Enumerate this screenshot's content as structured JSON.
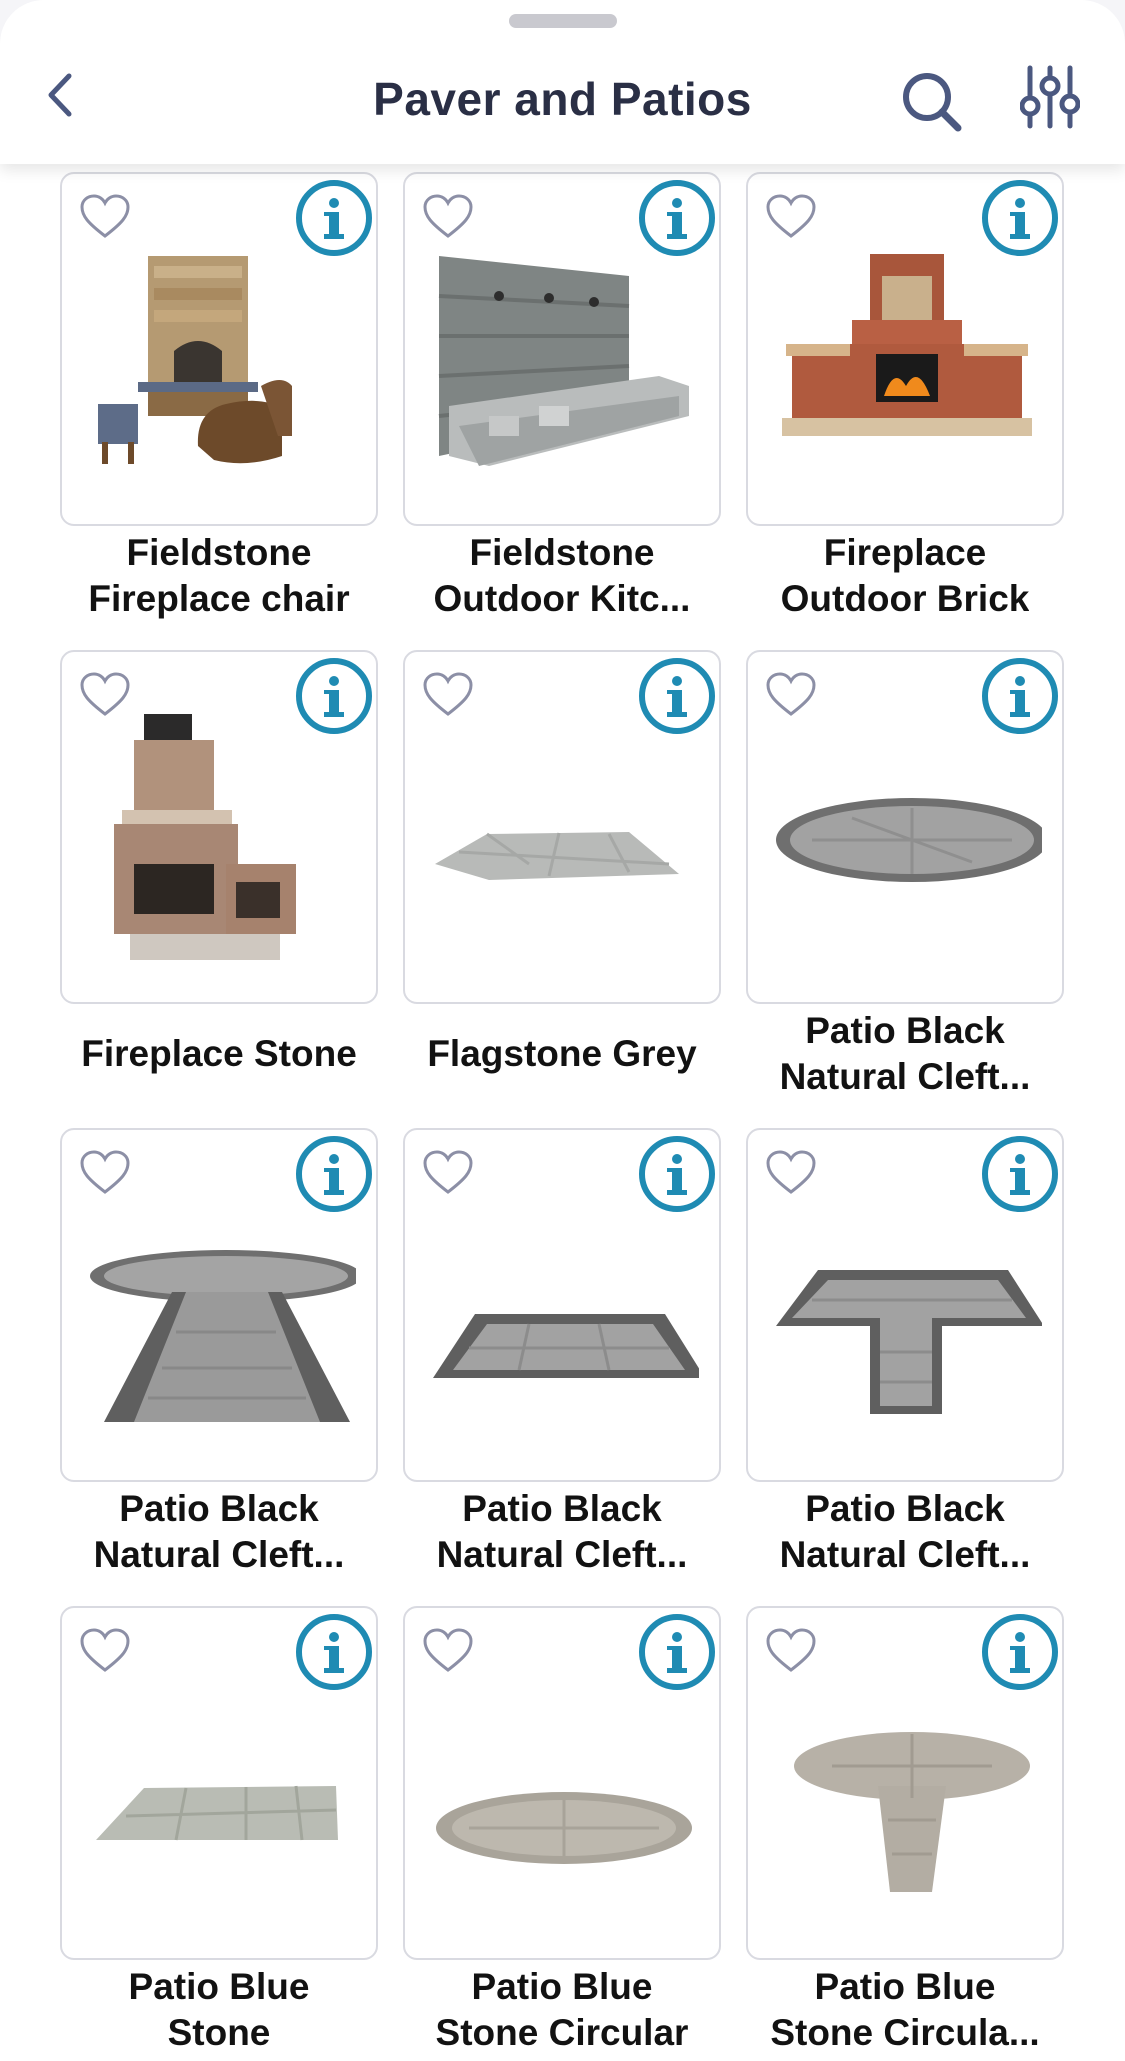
{
  "header": {
    "title": "Paver and Patios"
  },
  "colors": {
    "accent": "#1f8bb3",
    "title": "#2a2f45",
    "icon": "#4b5880",
    "heart": "#8c8fa6"
  },
  "icons": {
    "back": "chevron-left-icon",
    "search": "search-icon",
    "filter": "sliders-icon",
    "favorite": "heart-outline-icon",
    "info": "info-circle-icon"
  },
  "products": [
    {
      "line1": "Fieldstone",
      "line2": "Fireplace chair",
      "image": "fieldstone-fireplace-with-wicker-chairs"
    },
    {
      "line1": "Fieldstone",
      "line2": "Outdoor Kitc...",
      "image": "stone-outdoor-kitchen"
    },
    {
      "line1": "Fireplace",
      "line2": "Outdoor Brick",
      "image": "brick-outdoor-fireplace"
    },
    {
      "line1": "Fireplace Stone",
      "line2": "",
      "image": "stone-fireplace"
    },
    {
      "line1": "Flagstone Grey",
      "line2": "",
      "image": "grey-flagstone-slab"
    },
    {
      "line1": "Patio Black",
      "line2": "Natural Cleft...",
      "image": "round-grey-patio"
    },
    {
      "line1": "Patio Black",
      "line2": "Natural Cleft...",
      "image": "round-patio-with-path"
    },
    {
      "line1": "Patio Black",
      "line2": "Natural Cleft...",
      "image": "square-patio"
    },
    {
      "line1": "Patio Black",
      "line2": "Natural Cleft...",
      "image": "t-shaped-patio"
    },
    {
      "line1": "Patio Blue",
      "line2": "Stone",
      "image": "blue-stone-patio"
    },
    {
      "line1": "Patio Blue",
      "line2": "Stone Circular",
      "image": "blue-stone-circular-patio"
    },
    {
      "line1": "Patio Blue",
      "line2": "Stone Circula...",
      "image": "blue-stone-circular-patio-with-path"
    }
  ]
}
